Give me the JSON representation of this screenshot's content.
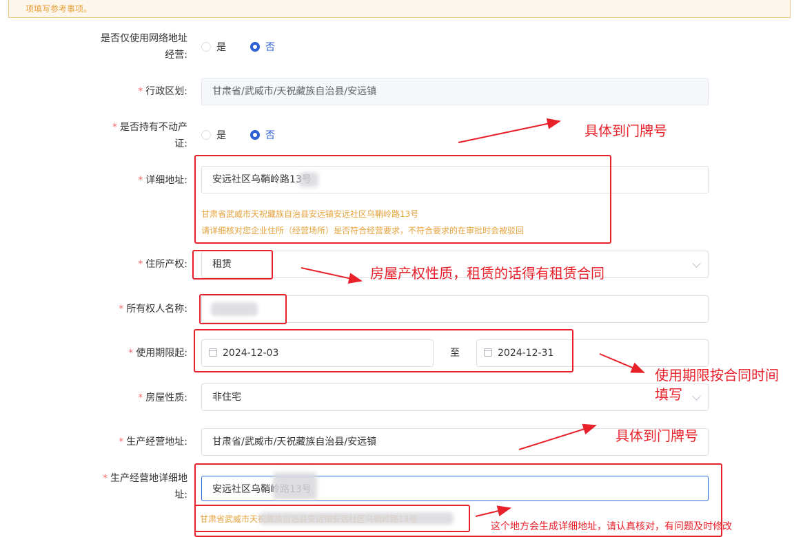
{
  "notice": {
    "text": "项填写参考事项。"
  },
  "form": {
    "online_only": {
      "label_line1": "是否仅使用网络地址",
      "label_line2": "经营:",
      "options": [
        {
          "label": "是",
          "checked": false
        },
        {
          "label": "否",
          "checked": true
        }
      ]
    },
    "admin_region": {
      "label": "行政区划:",
      "value": "甘肃省/武威市/天祝藏族自治县/安远镇"
    },
    "has_property_cert": {
      "label_line1": "是否持有不动产",
      "label_line2": "证:",
      "options": [
        {
          "label": "是",
          "checked": false
        },
        {
          "label": "否",
          "checked": true
        }
      ]
    },
    "detail_address": {
      "label": "详细地址:",
      "value": "安远社区乌鞘岭路13号",
      "hint1": "甘肃省武威市天祝藏族自治县安远镇安远社区乌鞘岭路13号",
      "hint2": "请详细核对您企业住所（经营场所）是否符合经营要求，不符合要求的在审批时会被驳回"
    },
    "property_right": {
      "label": "住所产权:",
      "value": "租赁"
    },
    "owner_name": {
      "label": "所有权人名称:",
      "value": ""
    },
    "period": {
      "label": "使用期限起:",
      "start": "2024-12-03",
      "separator": "至",
      "end": "2024-12-31"
    },
    "house_nature": {
      "label": "房屋性质:",
      "value": "非住宅"
    },
    "production_address": {
      "label": "生产经营地址:",
      "value": "甘肃省/武威市/天祝藏族自治县/安远镇"
    },
    "production_detail": {
      "label_line1": "生产经营地详细地",
      "label_line2": "址:",
      "value": "安远社区乌鞘岭路13号",
      "hint": "甘肃省武威市天祝藏族自治县安远镇安远社区乌鞘岭路13号"
    }
  },
  "annotations": {
    "a1": "具体到门牌号",
    "a2": "房屋产权性质，租赁的话得有租赁合同",
    "a3_line1": "使用期限按合同时间",
    "a3_line2": "填写",
    "a4": "具体到门牌号",
    "a5": "这个地方会生成详细地址，请认真核对，有问题及时修改"
  },
  "colors": {
    "accent": "#2d5fd6",
    "annotation": "#e8202a",
    "warning": "#e6a23c"
  }
}
